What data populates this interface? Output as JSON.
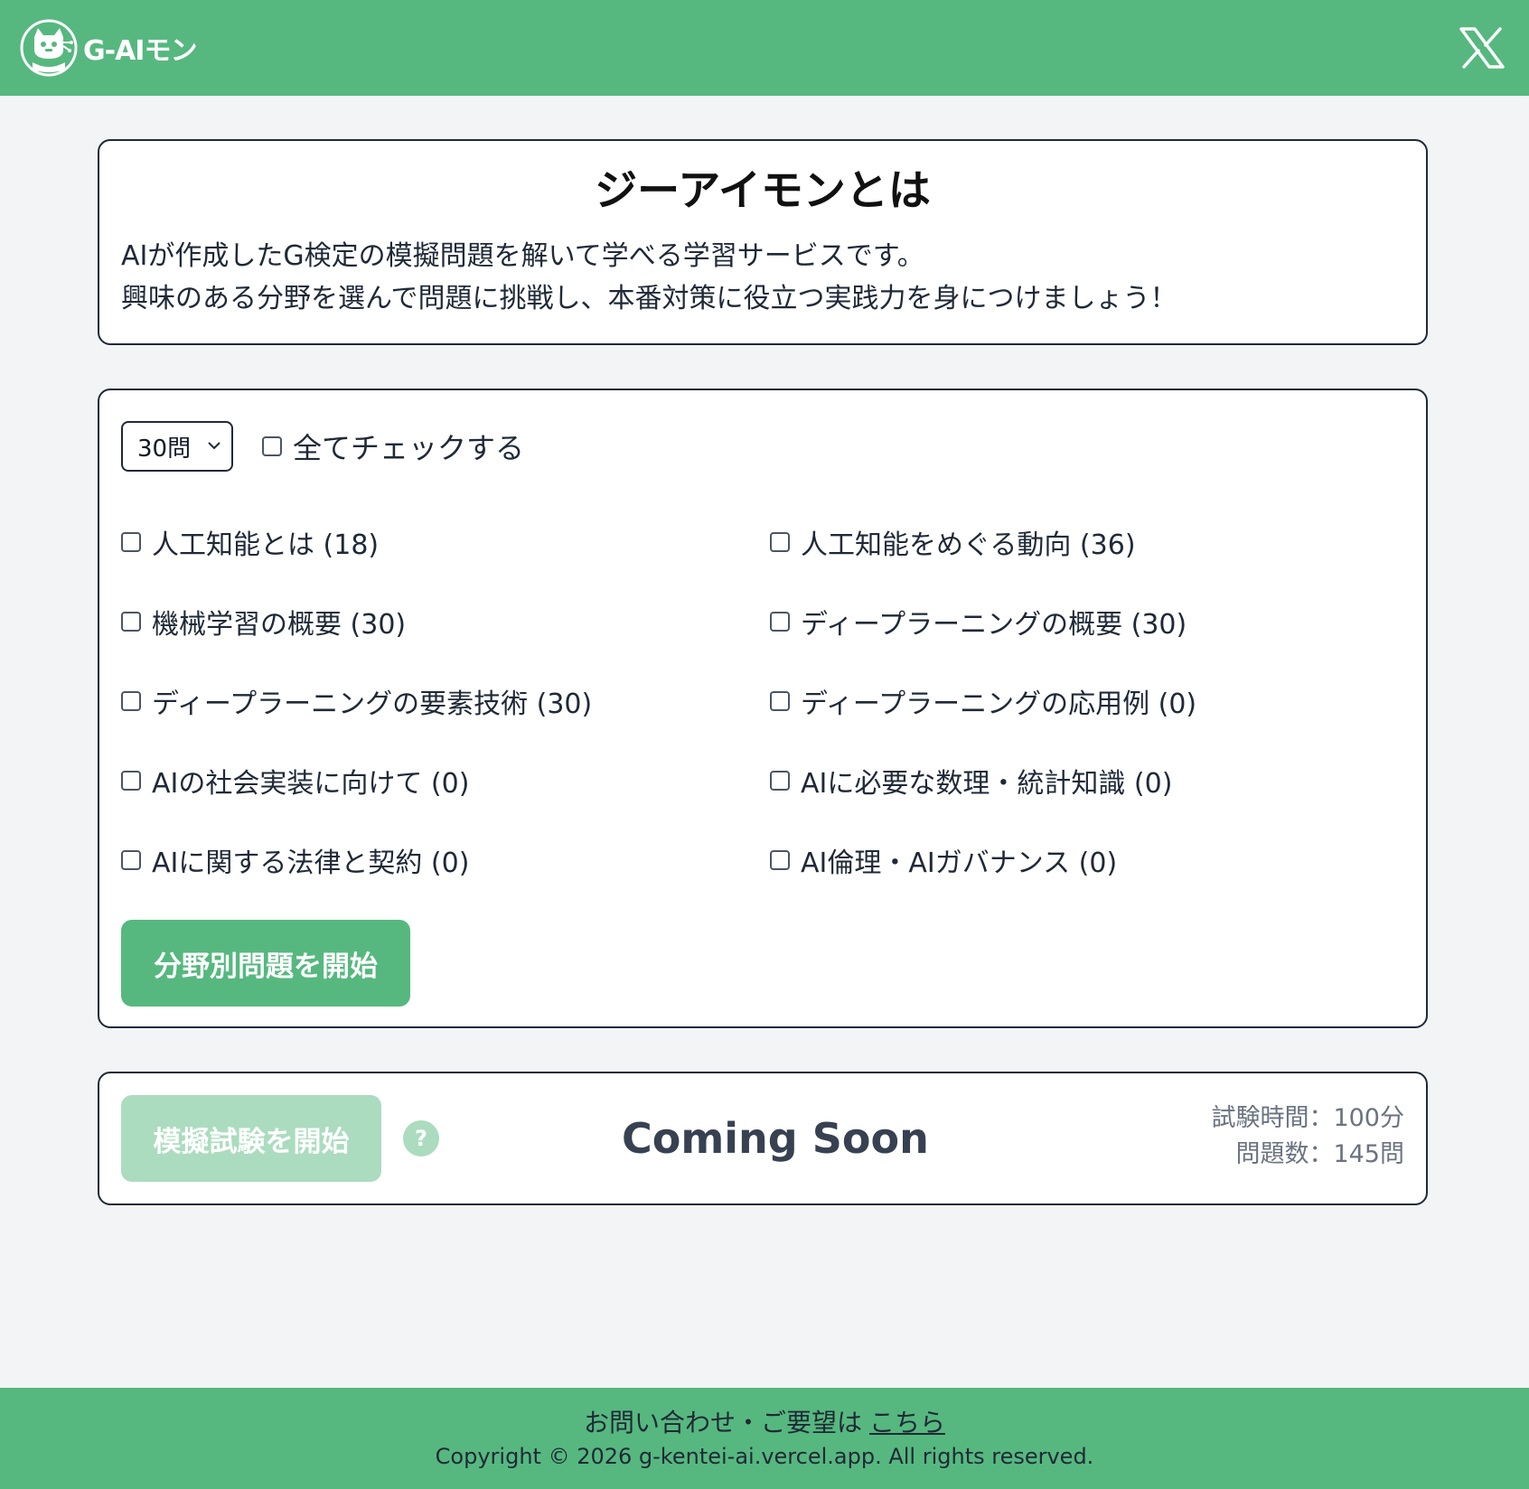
{
  "header": {
    "logo_text": "G-AIモン",
    "logo_icon": "cat-robot-logo-icon",
    "social_icon": "x-logo-icon"
  },
  "intro": {
    "title": "ジーアイモンとは",
    "line1": "AIが作成したG検定の模擬問題を解いて学べる学習サービスです。",
    "line2": "興味のある分野を選んで問題に挑戦し、本番対策に役立つ実践力を身につけましょう！"
  },
  "topics": {
    "question_count_selected": "30問",
    "check_all_label": "全てチェックする",
    "items": [
      {
        "label": "人工知能とは (18)"
      },
      {
        "label": "人工知能をめぐる動向 (36)"
      },
      {
        "label": "機械学習の概要 (30)"
      },
      {
        "label": "ディープラーニングの概要 (30)"
      },
      {
        "label": "ディープラーニングの要素技術 (30)"
      },
      {
        "label": "ディープラーニングの応用例 (0)"
      },
      {
        "label": "AIの社会実装に向けて (0)"
      },
      {
        "label": "AIに必要な数理・統計知識 (0)"
      },
      {
        "label": "AIに関する法律と契約 (0)"
      },
      {
        "label": "AI倫理・AIガバナンス (0)"
      }
    ],
    "start_label": "分野別問題を開始"
  },
  "exam": {
    "start_label": "模擬試験を開始",
    "help_symbol": "?",
    "coming_soon": "Coming Soon",
    "time_text": "試験時間：100分",
    "count_text": "問題数：145問"
  },
  "footer": {
    "contact_text": "お問い合わせ・ご要望は",
    "contact_link": "こちら",
    "copyright": "Copyright © 2026 g-kentei-ai.vercel.app. All rights reserved."
  },
  "colors": {
    "brand_green": "#56b87f",
    "disabled_green": "#abdcbf",
    "page_bg": "#f3f4f6"
  }
}
